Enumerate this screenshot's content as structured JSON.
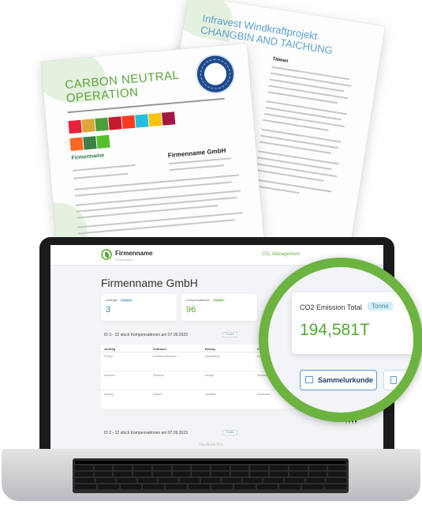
{
  "documents": {
    "back": {
      "title": "Infravest Windkraftprojekt CHANGBIN AND TAICHUNG",
      "subtitle": "Taiwan"
    },
    "front": {
      "title": "CARBON NEUTRAL OPERATION",
      "seal_text": "CARBON NEUTRAL OPERATION",
      "firm_label": "Firmenname",
      "company": "Firmenname GmbH"
    }
  },
  "app": {
    "logo_name": "Firmenname",
    "logo_tag": "Firmenname",
    "header_link": "CO₂ Management",
    "page_title": "Firmenname GmbH",
    "stats": [
      {
        "label": "Aufträge",
        "badge": "Gesamt",
        "value": "3",
        "color": "#3c8aa8"
      },
      {
        "label": "Kompensationen",
        "badge": "Gesamt",
        "value": "96",
        "color": "#55a832"
      }
    ],
    "sections": [
      {
        "text": "ID 3 - 32 stück Kompensationen am 07.09.2023",
        "button": "Details"
      },
      {
        "text": "ID 2 - 12 stück Kompensationen am 07.09.2023",
        "button": "Details"
      }
    ],
    "table": {
      "headers": [
        "Auftrag",
        "Zeitraum",
        "Betrag",
        "Zertifikat"
      ],
      "rows": [
        [
          "Projekt",
          "Emission Einheiten",
          "Ausstellung",
          "Download"
        ],
        [
          "Nummer",
          "Zeitraum",
          "Menge",
          "Download"
        ],
        [
          "Auftrag",
          "Einheit",
          "Zertifikat",
          "Download"
        ]
      ]
    }
  },
  "magnifier": {
    "label": "CO2 Emission Total",
    "badge": "Tonne",
    "value": "194,581T",
    "button_label": "Sammelurkunde",
    "chevron": "›"
  },
  "laptop": {
    "model": "MacBook Pro"
  },
  "colors": {
    "brand_green": "#6cb33f",
    "value_green": "#55a832",
    "accent_blue": "#3c8aa8"
  }
}
